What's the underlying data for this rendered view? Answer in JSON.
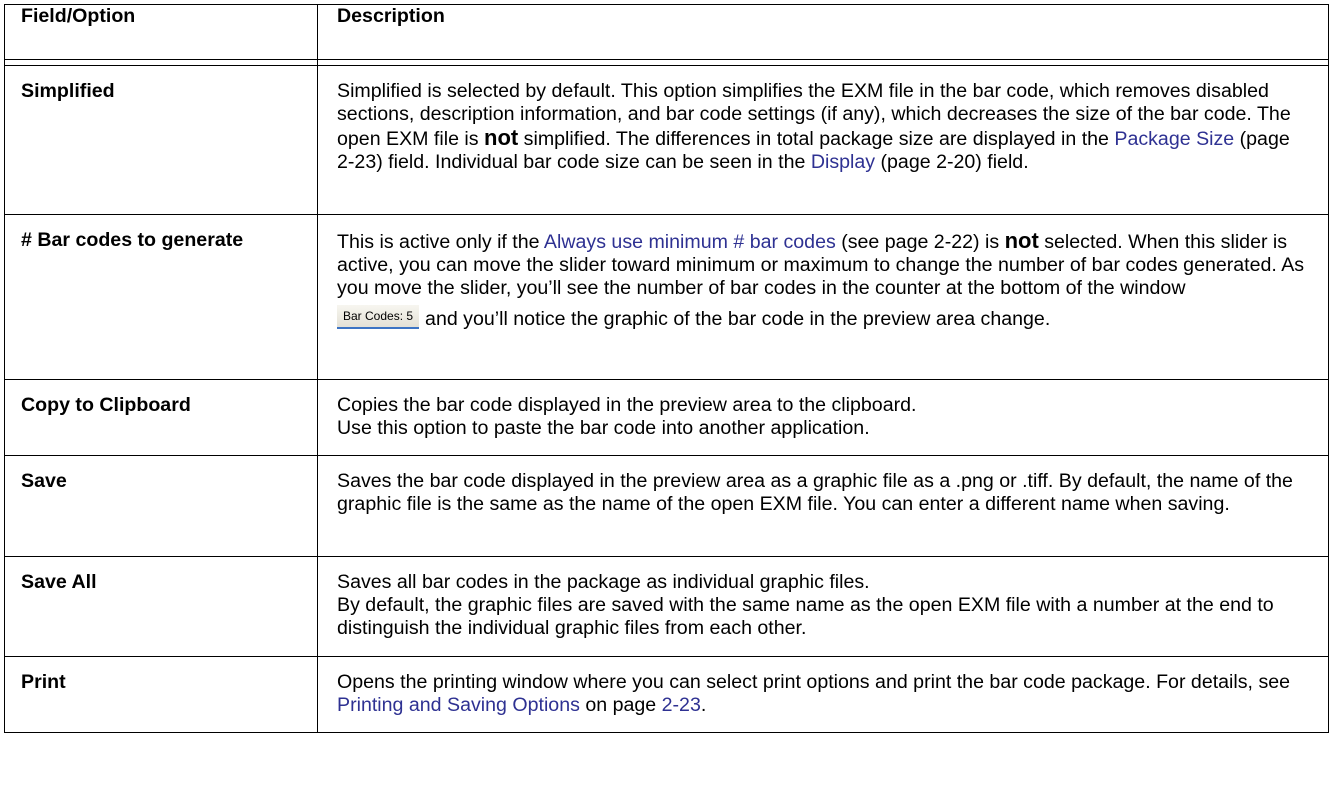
{
  "header": {
    "col1": "Field/Option",
    "col2": "Description"
  },
  "rows": [
    {
      "field": "Simplified",
      "desc": {
        "t1": "Simplified is selected by default. This option simplifies the EXM file in the bar code, which removes disabled sections, description information, and bar code settings (if any), which decreases the size of the bar code. The open EXM file is ",
        "bold": "not",
        "t2": " simplified. The differences in total package size are displayed in the ",
        "link1": "Package Size",
        "t3": " (page 2-23) field. Individual bar code size can be seen in the ",
        "link2": "Display",
        "t4": " (page 2-20) field."
      }
    },
    {
      "field": "# Bar codes to generate",
      "desc": {
        "t1": "This is active only if the ",
        "link1": "Always use minimum # bar codes",
        "t2": " (see page 2-22) is ",
        "bold": "not",
        "t3": " selected. When this slider is active, you can move the slider toward minimum or maximum to change the number of bar codes generated. As you move the slider, you’ll see the number of bar codes in the counter at the bottom of the window",
        "badge": "Bar Codes: 5",
        "t4": "and you’ll notice the graphic of the bar code in the preview area change."
      }
    },
    {
      "field": "Copy to Clipboard",
      "desc": {
        "line1": "Copies the bar code displayed in the preview area to the clipboard.",
        "line2": "Use this option to paste the bar code into another application."
      }
    },
    {
      "field": "Save",
      "desc": {
        "line1": "Saves the bar code displayed in the preview area as a graphic file as a .png or .tiff. By default, the name of the graphic file is the same as the name of the open EXM file. You can enter a different name when saving."
      }
    },
    {
      "field": "Save All",
      "desc": {
        "line1": "Saves all bar codes in the package as individual graphic files.",
        "line2": "By default, the graphic files are saved with the same name as the open EXM file with a number at the end to distinguish the individual graphic files from each other."
      }
    },
    {
      "field": "Print",
      "desc": {
        "t1": "Opens the printing window where you can select print options and print the bar code package. For details, see ",
        "link1": "Printing and Saving Options",
        "t2": " on page ",
        "link2": "2-23",
        "t3": "."
      }
    }
  ],
  "colors": {
    "link": "#2e3192",
    "border": "#000000",
    "badge_underline": "#3d74c4"
  }
}
